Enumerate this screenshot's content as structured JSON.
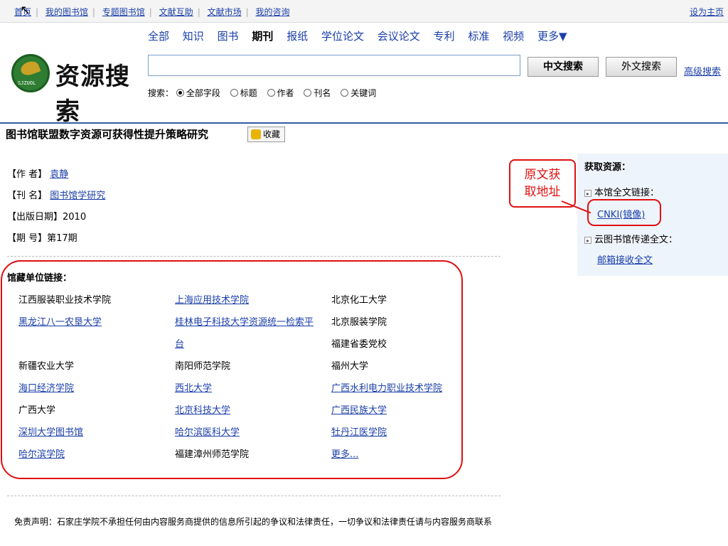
{
  "topnav": {
    "links": [
      "首页",
      "我的图书馆",
      "专题图书馆",
      "文献互助",
      "文献市场",
      "我的咨询"
    ],
    "set_home": "设为主页"
  },
  "logo": {
    "brand": "资源搜索",
    "small_text": "SJZUOL"
  },
  "categories": {
    "items": [
      "全部",
      "知识",
      "图书",
      "期刊",
      "报纸",
      "学位论文",
      "会议论文",
      "专利",
      "标准",
      "视频",
      "更多▼"
    ],
    "active": "期刊"
  },
  "search": {
    "value": "",
    "cn_button": "中文搜索",
    "en_button": "外文搜索",
    "advanced": "高级搜索",
    "options_label": "搜索：",
    "options": [
      "全部字段",
      "标题",
      "作者",
      "刊名",
      "关键词"
    ],
    "selected_option": "全部字段"
  },
  "article": {
    "title": "图书馆联盟数字资源可获得性提升策略研究",
    "favorite": "收藏",
    "author_label": "【作 者】",
    "author": "袁静",
    "journal_label": "【刊 名】",
    "journal": "图书馆学研究",
    "date_label": "【出版日期】",
    "date": "2010",
    "issue_label": "【期 号】",
    "issue": "第17期"
  },
  "holdings": {
    "label": "馆藏单位链接：",
    "rows": [
      [
        {
          "text": "江西服装职业技术学院",
          "link": false
        },
        {
          "text": "上海应用技术学院",
          "link": true
        },
        {
          "text": "北京化工大学",
          "link": false
        }
      ],
      [
        {
          "text": "黑龙江八一农垦大学",
          "link": true
        },
        {
          "text": "桂林电子科技大学资源统一检索平",
          "link": true
        },
        {
          "text": "北京服装学院",
          "link": false
        }
      ],
      [
        {
          "text": "",
          "link": false
        },
        {
          "text": "台",
          "link": true
        },
        {
          "text": "福建省委党校",
          "link": false
        }
      ],
      [
        {
          "text": "新疆农业大学",
          "link": false
        },
        {
          "text": "南阳师范学院",
          "link": false
        },
        {
          "text": "福州大学",
          "link": false
        }
      ],
      [
        {
          "text": "海口经济学院",
          "link": true
        },
        {
          "text": "西北大学",
          "link": true
        },
        {
          "text": "广西水利电力职业技术学院",
          "link": true
        }
      ],
      [
        {
          "text": "广西大学",
          "link": false
        },
        {
          "text": "北京科技大学",
          "link": true
        },
        {
          "text": "广西民族大学",
          "link": true
        }
      ],
      [
        {
          "text": "深圳大学图书馆",
          "link": true
        },
        {
          "text": "哈尔滨医科大学",
          "link": true
        },
        {
          "text": "牡丹江医学院",
          "link": true
        }
      ],
      [
        {
          "text": "哈尔滨学院",
          "link": true
        },
        {
          "text": "福建漳州师范学院",
          "link": false
        },
        {
          "text": "更多...",
          "link": true
        }
      ]
    ]
  },
  "resources": {
    "title": "获取资源：",
    "local_label": "本馆全文链接：",
    "cnki": "CNKI(镜像)",
    "cloud_label": "云图书馆传递全文：",
    "email": "邮箱接收全文"
  },
  "callout": {
    "line1": "原文获",
    "line2": "取地址"
  },
  "disclaimer": "免责声明：石家庄学院不承担任何由内容服务商提供的信息所引起的争议和法律责任，一切争议和法律责任请与内容服务商联系",
  "colors": {
    "link": "#1a3ea8",
    "accent_red": "#e01010",
    "divider": "#2f5e9e",
    "panel_bg": "#eef4fb"
  }
}
